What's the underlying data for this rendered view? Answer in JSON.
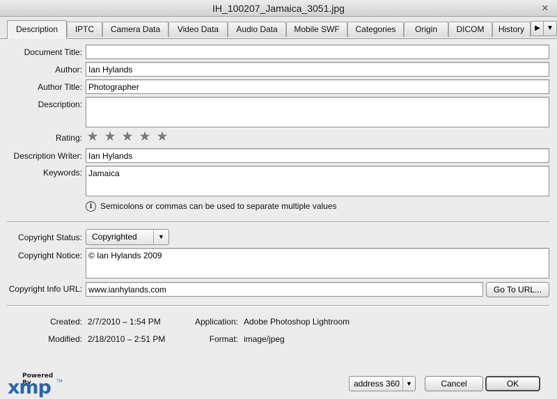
{
  "window": {
    "title": "IH_100207_Jamaica_3051.jpg"
  },
  "tabs": [
    {
      "label": "Description",
      "active": true
    },
    {
      "label": "IPTC"
    },
    {
      "label": "Camera Data"
    },
    {
      "label": "Video Data"
    },
    {
      "label": "Audio Data"
    },
    {
      "label": "Mobile SWF"
    },
    {
      "label": "Categories"
    },
    {
      "label": "Origin"
    },
    {
      "label": "DICOM"
    },
    {
      "label": "History"
    }
  ],
  "fields": {
    "document_title": {
      "label": "Document Title:",
      "value": ""
    },
    "author": {
      "label": "Author:",
      "value": "Ian Hylands"
    },
    "author_title": {
      "label": "Author Title:",
      "value": "Photographer"
    },
    "description": {
      "label": "Description:",
      "value": ""
    },
    "rating": {
      "label": "Rating:",
      "stars": 5,
      "filled": 0
    },
    "description_writer": {
      "label": "Description Writer:",
      "value": "Ian Hylands"
    },
    "keywords": {
      "label": "Keywords:",
      "value": "Jamaica"
    },
    "keywords_hint": "Semicolons or commas can be used to separate multiple values",
    "copyright_status": {
      "label": "Copyright Status:",
      "value": "Copyrighted"
    },
    "copyright_notice": {
      "label": "Copyright Notice:",
      "value": "© Ian Hylands 2009"
    },
    "copyright_url": {
      "label": "Copyright Info URL:",
      "value": "www.ianhylands.com",
      "button": "Go To URL..."
    }
  },
  "meta": {
    "created": {
      "label": "Created:",
      "value": "2/7/2010 – 1:54 PM"
    },
    "modified": {
      "label": "Modified:",
      "value": "2/18/2010 – 2:51 PM"
    },
    "application": {
      "label": "Application:",
      "value": "Adobe Photoshop Lightroom"
    },
    "format": {
      "label": "Format:",
      "value": "image/jpeg"
    }
  },
  "footer": {
    "logo_powered": "Powered By",
    "logo_mark": "xmp",
    "logo_tm": "TM",
    "template": "address 360",
    "cancel": "Cancel",
    "ok": "OK"
  },
  "colors": {
    "accent": "#2467b0",
    "star": "#7a7a7a"
  }
}
